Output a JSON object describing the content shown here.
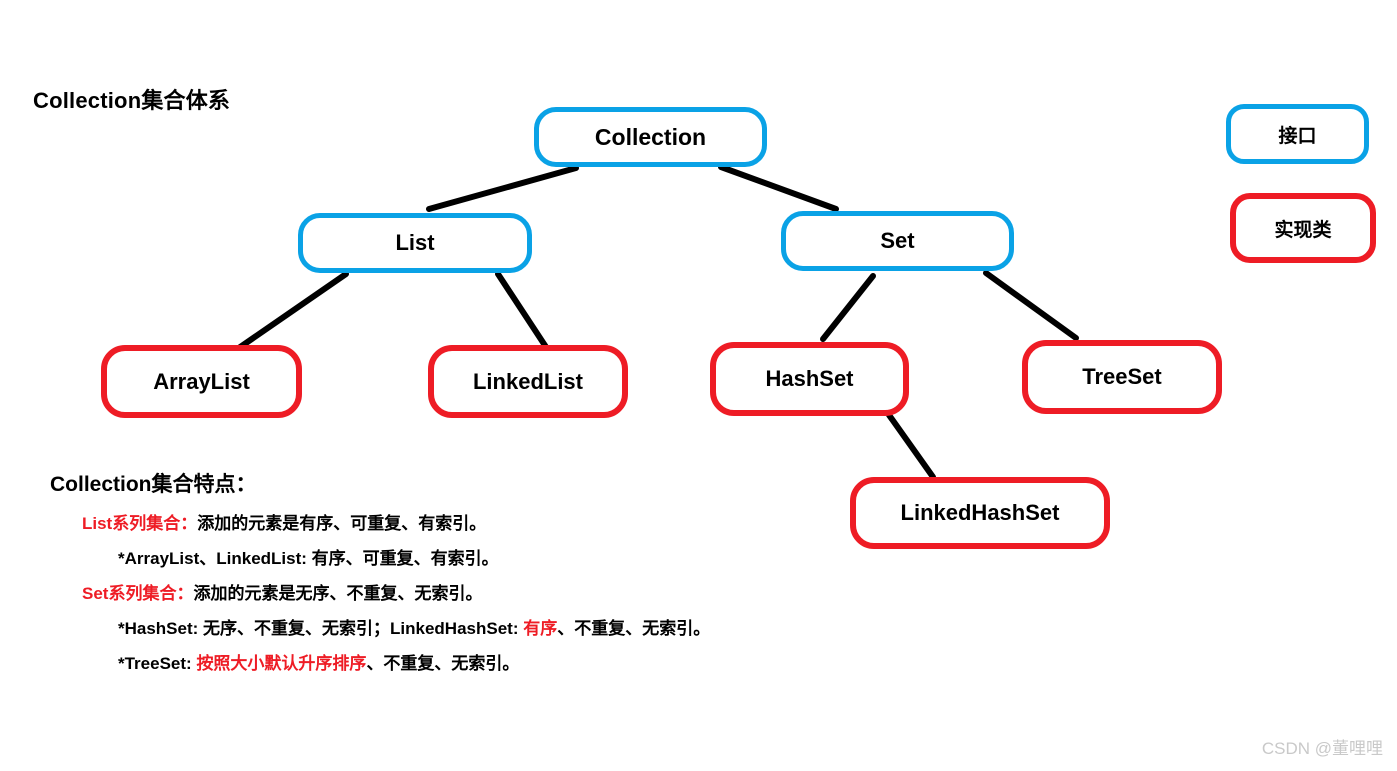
{
  "diagram": {
    "title": "Collection集合体系",
    "colors": {
      "interface_border": "#0aa2e6",
      "implementation_border": "#ee1c25",
      "connector": "#000000",
      "text": "#000000",
      "highlight": "#ee1c25",
      "watermark": "#c9c9c9",
      "background": "#ffffff"
    },
    "nodes": [
      {
        "id": "collection",
        "label": "Collection",
        "kind": "interface"
      },
      {
        "id": "list",
        "label": "List",
        "kind": "interface"
      },
      {
        "id": "set",
        "label": "Set",
        "kind": "interface"
      },
      {
        "id": "arraylist",
        "label": "ArrayList",
        "kind": "implementation"
      },
      {
        "id": "linkedlist",
        "label": "LinkedList",
        "kind": "implementation"
      },
      {
        "id": "hashset",
        "label": "HashSet",
        "kind": "implementation"
      },
      {
        "id": "treeset",
        "label": "TreeSet",
        "kind": "implementation"
      },
      {
        "id": "linkedhashset",
        "label": "LinkedHashSet",
        "kind": "implementation"
      }
    ],
    "edges": [
      {
        "from": "collection",
        "to": "list"
      },
      {
        "from": "collection",
        "to": "set"
      },
      {
        "from": "list",
        "to": "arraylist"
      },
      {
        "from": "list",
        "to": "linkedlist"
      },
      {
        "from": "set",
        "to": "hashset"
      },
      {
        "from": "set",
        "to": "treeset"
      },
      {
        "from": "hashset",
        "to": "linkedhashset"
      }
    ]
  },
  "legend": {
    "interface_label": "接口",
    "implementation_label": "实现类"
  },
  "notes": {
    "heading": "Collection集合特点：",
    "line1": {
      "red": "List系列集合：",
      "black": "添加的元素是有序、可重复、有索引。"
    },
    "line2": {
      "black": "*ArrayList、LinkedList: 有序、可重复、有索引。"
    },
    "line3": {
      "red": "Set系列集合：",
      "black": "添加的元素是无序、不重复、无索引。"
    },
    "line4": {
      "black_a": "*HashSet: 无序、不重复、无索引；LinkedHashSet: ",
      "red": "有序",
      "black_b": "、不重复、无索引。"
    },
    "line5": {
      "black_a": "*TreeSet: ",
      "red": "按照大小默认升序排序",
      "black_b": "、不重复、无索引。"
    }
  },
  "watermark": {
    "text": "CSDN @董哩哩"
  }
}
